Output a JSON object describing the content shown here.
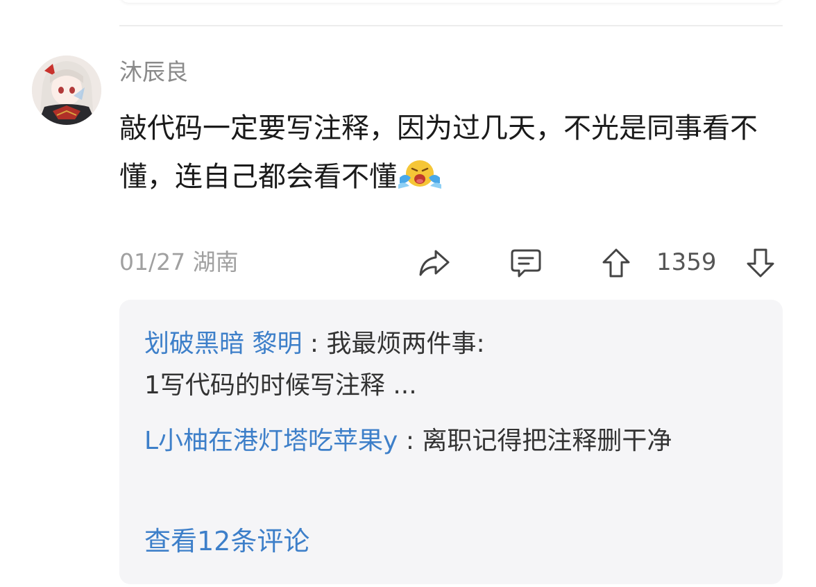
{
  "comment": {
    "username": "沐辰良",
    "text": "敲代码一定要写注释，因为过几天，不光是同事看不懂，连自己都会看不懂",
    "emoji": "crying-face-emoji",
    "date": "01/27",
    "location": "湖南",
    "upvotes": "1359"
  },
  "actions": {
    "share_icon": "share-icon",
    "reply_icon": "comment-icon",
    "upvote_icon": "upvote-icon",
    "downvote_icon": "downvote-icon"
  },
  "replies": [
    {
      "author": "划破黑暗 黎明",
      "separator": " : ",
      "text": "我最烦两件事:\n1写代码的时候写注释 ..."
    },
    {
      "author": "L小柚在港灯塔吃苹果y",
      "separator": " : ",
      "text": "离职记得把注释删干净"
    }
  ],
  "view_more": "查看12条评论",
  "colors": {
    "link_blue": "#3d7fc9",
    "text_dark": "#1a1a1a",
    "text_gray": "#a0a0a0",
    "reply_bg": "#f5f5f7"
  }
}
